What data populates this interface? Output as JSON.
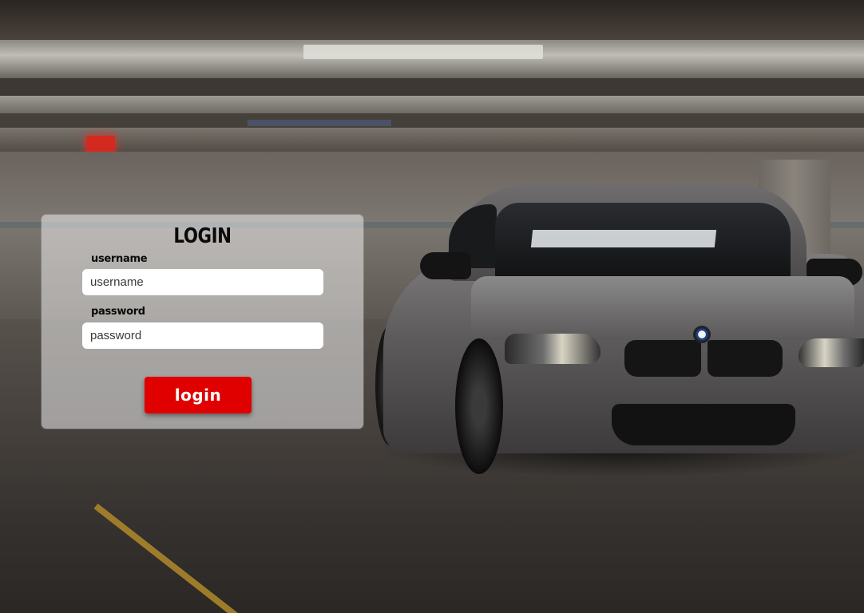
{
  "login": {
    "title": "LOGIN",
    "username_label": "username",
    "username_placeholder": "username",
    "username_value": "",
    "password_label": "password",
    "password_placeholder": "password",
    "password_value": "",
    "button_label": "login"
  },
  "colors": {
    "button": "#e00000",
    "panel": "#ececec"
  }
}
